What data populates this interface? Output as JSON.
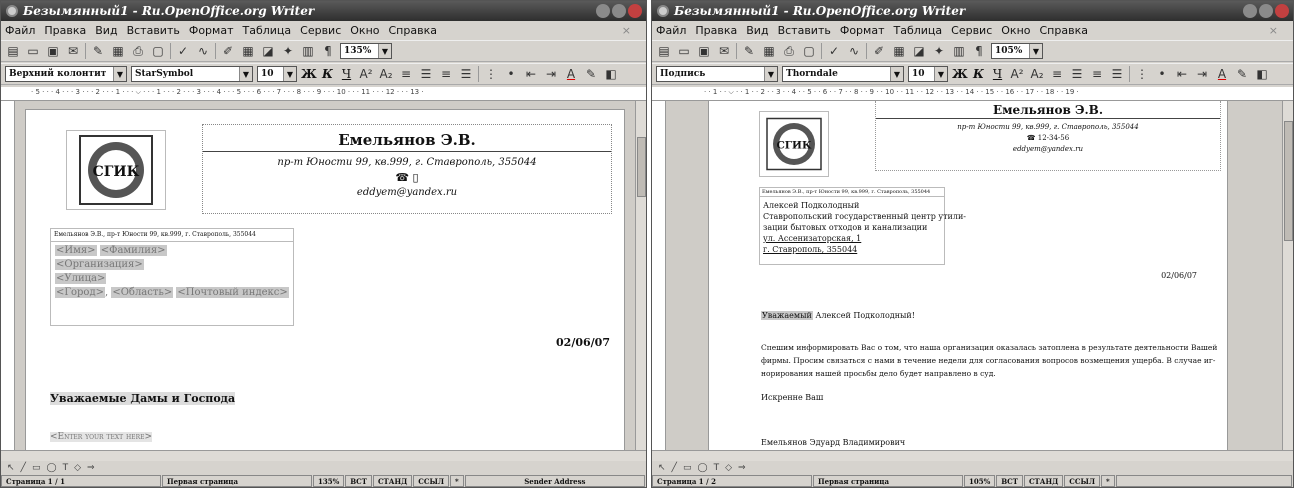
{
  "left": {
    "title": "Безымянный1 - Ru.OpenOffice.org Writer",
    "menu": [
      "Файл",
      "Правка",
      "Вид",
      "Вставить",
      "Формат",
      "Таблица",
      "Сервис",
      "Окно",
      "Справка"
    ],
    "close_mark": "×",
    "zoom_combo": "135%",
    "style_combo": "Верхний колонтит",
    "font_combo": "StarSymbol",
    "size_combo": "10",
    "ruler_text": "· 5 · · · 4 · · · 3 · · · 2 · · · 1 · · · ⌵ · · · 1 · · · 2 · · · 3 · · · 4 · · · 5 · · · 6 · · · 7 · · · 8 · · · 9 · · · 10 · · · 11 · · · 12 · · · 13 ·",
    "sender_name": "Емельянов Э.В.",
    "sender_address": "пр-т Юности 99, кв.999, г. Ставрополь,  355044",
    "phone_line": "☎ ▯",
    "email": "eddyem@yandex.ru",
    "return_address": "Емельянов Э.В., пр-т Юности 99, кв.999, г. Ставрополь,  355044",
    "recipient_fields": {
      "name": "<Имя>",
      "surname": "<Фамилия>",
      "organization": "<Организация>",
      "street": "<Улица>",
      "city": "<Город>",
      "comma": ",",
      "region": "<Область>",
      "postcode": "<Почтовый индекс>"
    },
    "date": "02/06/07",
    "greeting": "Уважаемые Дамы и Господа",
    "body_placeholder": "<Enter your text here>",
    "logo_text": "СГИК",
    "status": {
      "page": "Страница 1 / 1",
      "style": "Первая страница",
      "zoom": "135%",
      "ins": "ВСТ",
      "std": "СТАНД",
      "link": "ССЫЛ",
      "star": "*",
      "section": "Sender Address"
    }
  },
  "right": {
    "title": "Безымянный1 - Ru.OpenOffice.org Writer",
    "menu": [
      "Файл",
      "Правка",
      "Вид",
      "Вставить",
      "Формат",
      "Таблица",
      "Сервис",
      "Окно",
      "Справка"
    ],
    "close_mark": "×",
    "zoom_combo": "105%",
    "style_combo": "Подпись",
    "font_combo": "Thorndale",
    "size_combo": "10",
    "ruler_text": "· · 1 · · ⌵ · · 1 · · 2 · · 3 · · 4 · · 5 · · 6 · · 7 · · 8 · · 9 · · 10 · · 11 · · 12 · · 13 · · 14 · · 15 · · 16 · · 17 · · 18 · · 19 ·",
    "sender_name": "Емельянов Э.В.",
    "sender_address": "пр-т Юности 99, кв.999, г. Ставрополь,  355044",
    "phone_line": "☎ 12-34-56",
    "email": "eddyem@yandex.ru",
    "return_address": "Емельянов Э.В., пр-т Юности 99, кв.999, г. Ставрополь,  355044",
    "recipient_lines": [
      "Алексей Подколодный",
      "Ставропольский государственный центр утили-",
      "зации бытовых отходов и канализации",
      "ул. Ассенизаторская, 1",
      "г. Ставрополь, 355044"
    ],
    "date": "02/06/07",
    "greeting_word": "Уважаемый",
    "greeting_name": " Алексей Подколодный!",
    "body_lines": [
      "Спешим информировать Вас о том, что наша организация оказалась затоплена в результате деятельности Вашей",
      "фирмы. Просим связаться с нами в течение недели для согласования вопросов возмещения ущерба. В случае иг-",
      "норирования нашей просьбы дело будет направлено в суд."
    ],
    "closing": "Искренне Ваш",
    "signature": "Емельянов Эдуард Владимирович",
    "logo_text": "СГИК",
    "status": {
      "page": "Страница 1 / 2",
      "style": "Первая страница",
      "zoom": "105%",
      "ins": "ВСТ",
      "std": "СТАНД",
      "link": "ССЫЛ",
      "star": "*",
      "section": ""
    }
  }
}
